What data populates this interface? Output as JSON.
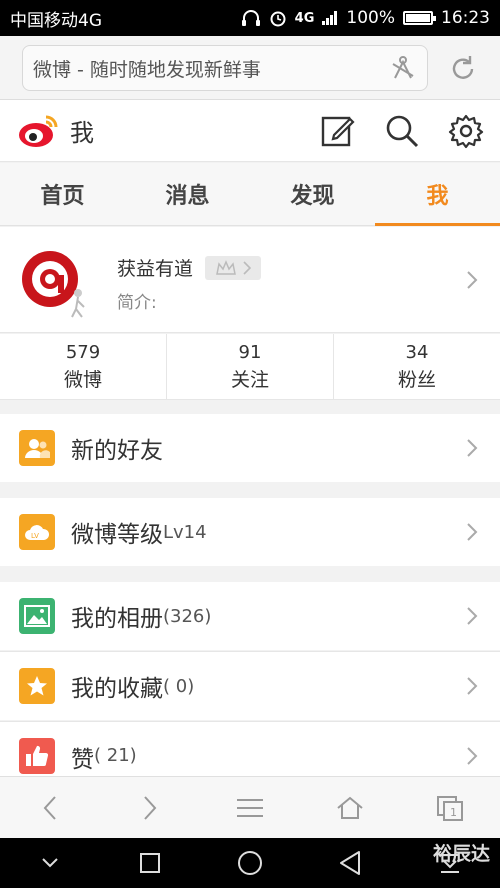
{
  "status_bar": {
    "carrier": "中国移动4G",
    "network": "4G",
    "battery": "100%",
    "time": "16:23"
  },
  "browser": {
    "page_title": "微博 - 随时随地发现新鲜事"
  },
  "app_header": {
    "title": "我"
  },
  "tabs": [
    {
      "label": "首页"
    },
    {
      "label": "消息"
    },
    {
      "label": "发现"
    },
    {
      "label": "我"
    }
  ],
  "profile": {
    "name": "获益有道",
    "bio_label": "简介:"
  },
  "stats": [
    {
      "value": "579",
      "label": "微博"
    },
    {
      "value": "91",
      "label": "关注"
    },
    {
      "value": "34",
      "label": "粉丝"
    }
  ],
  "menu": {
    "new_friends": {
      "label": "新的好友"
    },
    "level": {
      "label": "微博等级",
      "value": "Lv14"
    },
    "album": {
      "label": "我的相册",
      "count": "(326)"
    },
    "favorites": {
      "label": "我的收藏",
      "count": "( 0)"
    },
    "likes": {
      "label": "赞",
      "count": "( 21)"
    }
  },
  "watermark": "裕辰达",
  "colors": {
    "accent": "#f28a1e",
    "icon_orange": "#f5a623",
    "icon_green": "#3cb371",
    "icon_red": "#f05a4f"
  }
}
